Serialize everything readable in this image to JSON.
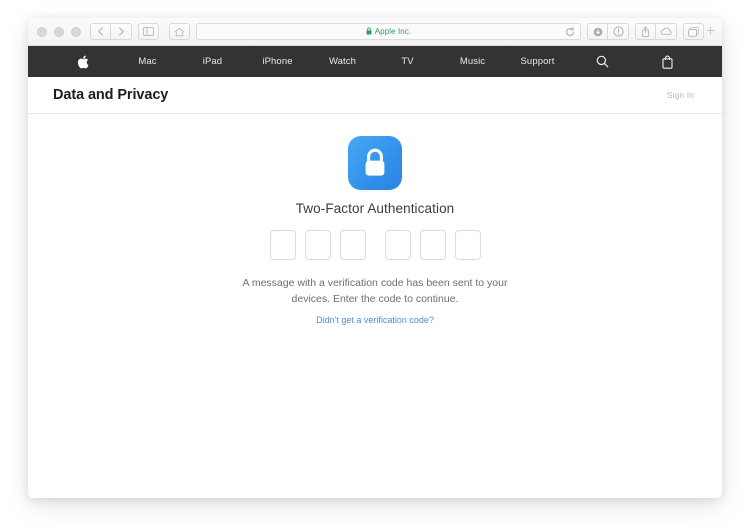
{
  "window": {
    "traffic_lights": [
      "close",
      "minimize",
      "zoom"
    ],
    "toolbar": {
      "back_icon": "chevron-left-icon",
      "forward_icon": "chevron-right-icon",
      "sidebar_icon": "sidebar-icon",
      "home_icon": "home-icon",
      "url_text": "Apple Inc.",
      "url_lock_icon": "lock-icon",
      "reload_icon": "reload-icon",
      "downloads_icon": "downloads-icon",
      "info_icon": "info-icon",
      "share_icon": "share-icon",
      "icloud_icon": "icloud-icon",
      "tabs_icon": "tabs-icon",
      "new_tab_icon": "plus-icon"
    }
  },
  "global_nav": {
    "items": [
      {
        "label": "",
        "icon": "apple-logo-icon"
      },
      {
        "label": "Mac",
        "icon": ""
      },
      {
        "label": "iPad",
        "icon": ""
      },
      {
        "label": "iPhone",
        "icon": ""
      },
      {
        "label": "Watch",
        "icon": ""
      },
      {
        "label": "TV",
        "icon": ""
      },
      {
        "label": "Music",
        "icon": ""
      },
      {
        "label": "Support",
        "icon": ""
      },
      {
        "label": "",
        "icon": "search-icon"
      },
      {
        "label": "",
        "icon": "shopping-bag-icon"
      }
    ]
  },
  "page": {
    "title": "Data and Privacy",
    "sign_in_label": "Sign In",
    "auth": {
      "icon": "lock-icon",
      "heading": "Two-Factor Authentication",
      "code_length": 6,
      "code_values": [
        "",
        "",
        "",
        "",
        "",
        ""
      ],
      "message": "A message with a verification code has been sent to your devices. Enter the code to continue.",
      "help_link": "Didn't get a verification code?"
    }
  },
  "colors": {
    "nav_background": "#333333",
    "link_blue": "#4a90d9",
    "lock_blue": "#3b9bf0",
    "url_green": "#2f9e5c",
    "title_dark": "#1d1d1f",
    "body_gray": "#6f6f6f"
  }
}
